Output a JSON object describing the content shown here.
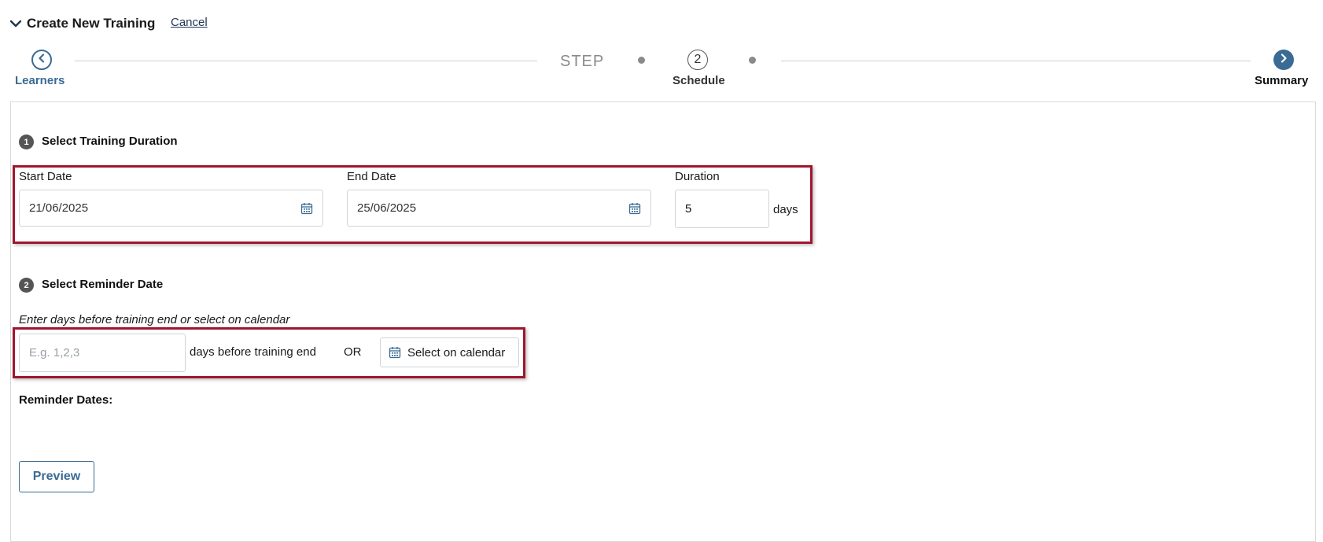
{
  "header": {
    "title": "Create New Training",
    "cancel_label": "Cancel"
  },
  "stepper": {
    "step_word": "STEP",
    "prev": {
      "label": "Learners",
      "icon": "chevron-left-icon"
    },
    "current": {
      "number": "2",
      "label": "Schedule"
    },
    "next": {
      "label": "Summary",
      "icon": "chevron-right-icon"
    }
  },
  "duration_section": {
    "number": "1",
    "title": "Select Training Duration",
    "start_date": {
      "label": "Start Date",
      "value": "21/06/2025"
    },
    "end_date": {
      "label": "End Date",
      "value": "25/06/2025"
    },
    "duration": {
      "label": "Duration",
      "value": "5",
      "unit": "days"
    }
  },
  "reminder_section": {
    "number": "2",
    "title": "Select Reminder Date",
    "hint": "Enter days before training end or select on calendar",
    "days_input_placeholder": "E.g. 1,2,3",
    "days_suffix": "days before training end",
    "or_label": "OR",
    "select_calendar_label": "Select on calendar",
    "reminder_dates_label": "Reminder Dates:"
  },
  "actions": {
    "preview_label": "Preview"
  },
  "colors": {
    "accent": "#3a6b94",
    "highlight": "#a0162e",
    "dark_text": "#1f3550"
  }
}
